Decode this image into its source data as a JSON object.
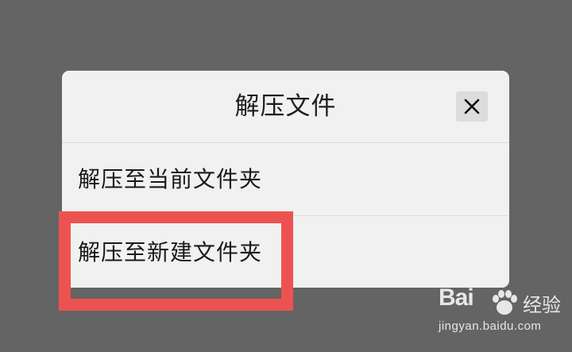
{
  "dialog": {
    "title": "解压文件",
    "close_icon": "close-icon",
    "items": [
      {
        "label": "解压至当前文件夹"
      },
      {
        "label": "解压至新建文件夹"
      }
    ]
  },
  "highlight": {
    "color": "#ec5350"
  },
  "watermark": {
    "logo_text": "Bai",
    "logo_suffix": "经验",
    "url": "jingyan.baidu.com"
  },
  "colors": {
    "backdrop": "#646464",
    "dialog_bg": "#f1f1f1"
  }
}
